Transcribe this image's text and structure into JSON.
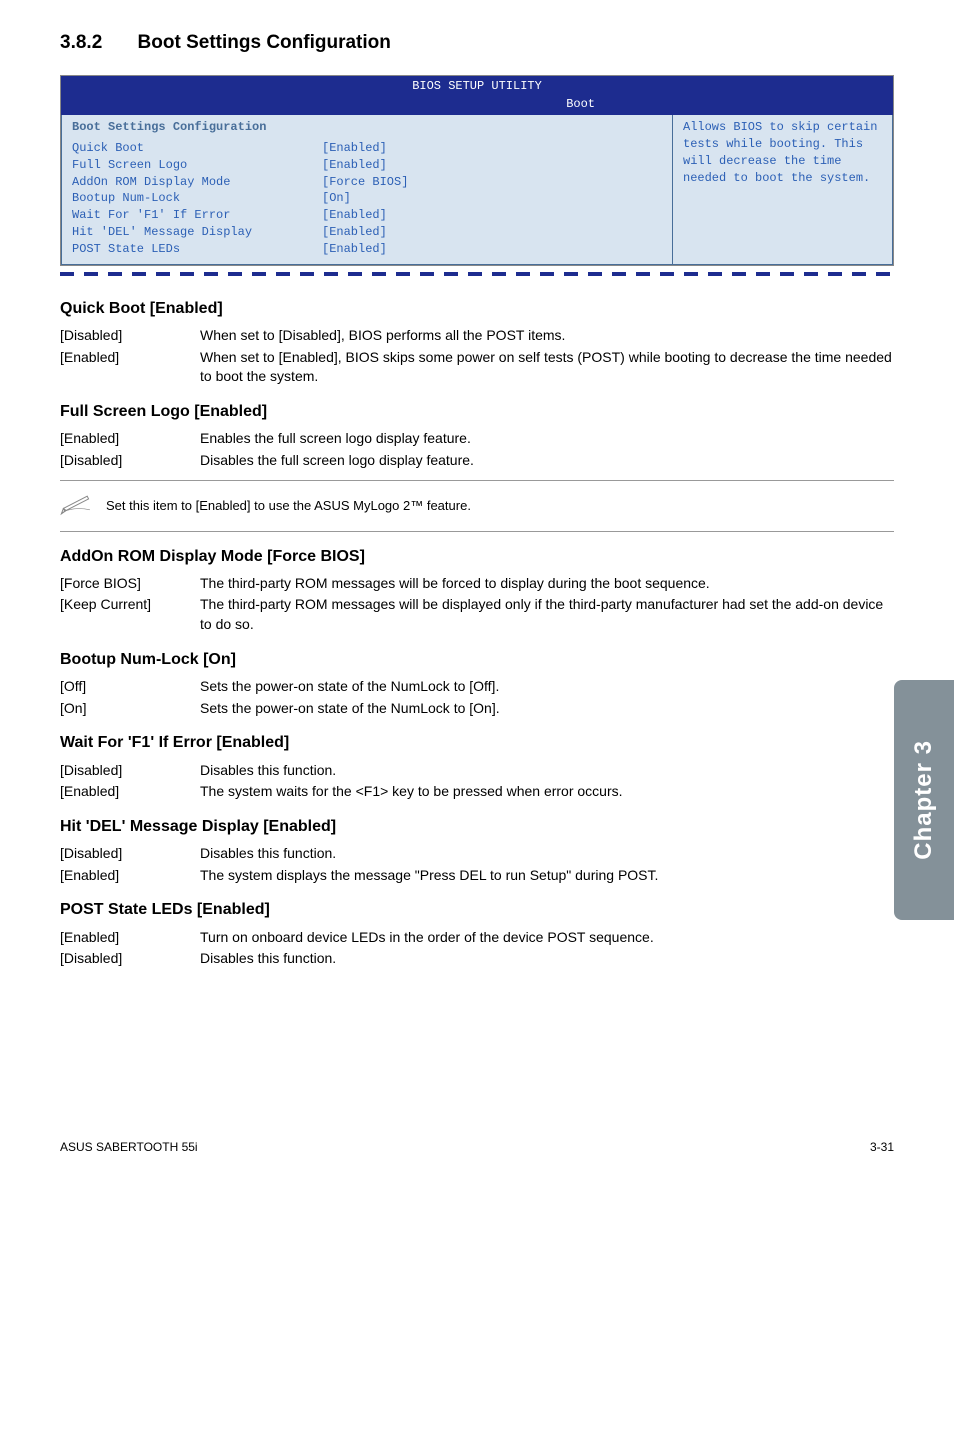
{
  "section": {
    "number": "3.8.2",
    "title": "Boot Settings Configuration"
  },
  "bios": {
    "header": "BIOS SETUP UTILITY",
    "tab": "Boot",
    "heading": "Boot Settings Configuration",
    "rows": [
      {
        "label": "Quick Boot",
        "value": "[Enabled]"
      },
      {
        "label": "Full Screen Logo",
        "value": "[Enabled]"
      },
      {
        "label": "AddOn ROM Display Mode",
        "value": "[Force BIOS]"
      },
      {
        "label": "Bootup Num-Lock",
        "value": "[On]"
      },
      {
        "label": "Wait For 'F1' If Error",
        "value": "[Enabled]"
      },
      {
        "label": "Hit 'DEL' Message Display",
        "value": "[Enabled]"
      },
      {
        "label": "POST State LEDs",
        "value": "[Enabled]"
      }
    ],
    "help": "Allows BIOS to skip certain tests while booting. This will decrease the time needed to boot the system."
  },
  "quick_boot": {
    "title": "Quick Boot [Enabled]",
    "rows": [
      {
        "key": "[Disabled]",
        "val": "When set to [Disabled], BIOS performs all the POST items."
      },
      {
        "key": "[Enabled]",
        "val": "When set to [Enabled], BIOS skips some power on self tests (POST) while booting to decrease the time needed to boot the system."
      }
    ]
  },
  "full_screen": {
    "title": "Full Screen Logo [Enabled]",
    "rows": [
      {
        "key": "[Enabled]",
        "val": "Enables the full screen logo display feature."
      },
      {
        "key": "[Disabled]",
        "val": "Disables the full screen logo display feature."
      }
    ]
  },
  "note": "Set this item to [Enabled] to use the ASUS MyLogo 2™ feature.",
  "addon": {
    "title": "AddOn ROM Display Mode [Force BIOS]",
    "rows": [
      {
        "key": "[Force BIOS]",
        "val": "The third-party ROM messages will be forced to display during the boot sequence."
      },
      {
        "key": "[Keep Current]",
        "val": "The third-party ROM messages will be displayed only if the third-party manufacturer had set the add-on device to do so."
      }
    ]
  },
  "bootup": {
    "title": "Bootup Num-Lock [On]",
    "rows": [
      {
        "key": "[Off]",
        "val": "Sets the power-on state of the NumLock to [Off]."
      },
      {
        "key": "[On]",
        "val": "Sets the power-on state of the NumLock to [On]."
      }
    ]
  },
  "wait_f1": {
    "title": "Wait For 'F1' If Error [Enabled]",
    "rows": [
      {
        "key": "[Disabled]",
        "val": "Disables this function."
      },
      {
        "key": "[Enabled]",
        "val": "The system waits for the <F1> key to be pressed when error occurs."
      }
    ]
  },
  "hit_del": {
    "title": "Hit 'DEL' Message Display [Enabled]",
    "rows": [
      {
        "key": "[Disabled]",
        "val": "Disables this function."
      },
      {
        "key": "[Enabled]",
        "val": "The system displays the message \"Press DEL to run Setup\" during POST."
      }
    ]
  },
  "post_leds": {
    "title": "POST State LEDs [Enabled]",
    "rows": [
      {
        "key": "[Enabled]",
        "val": "Turn on onboard device LEDs in the order of the device POST sequence."
      },
      {
        "key": "[Disabled]",
        "val": "Disables this function."
      }
    ]
  },
  "footer": {
    "left": "ASUS SABERTOOTH 55i",
    "right": "3-31"
  },
  "side_tab": "Chapter 3"
}
